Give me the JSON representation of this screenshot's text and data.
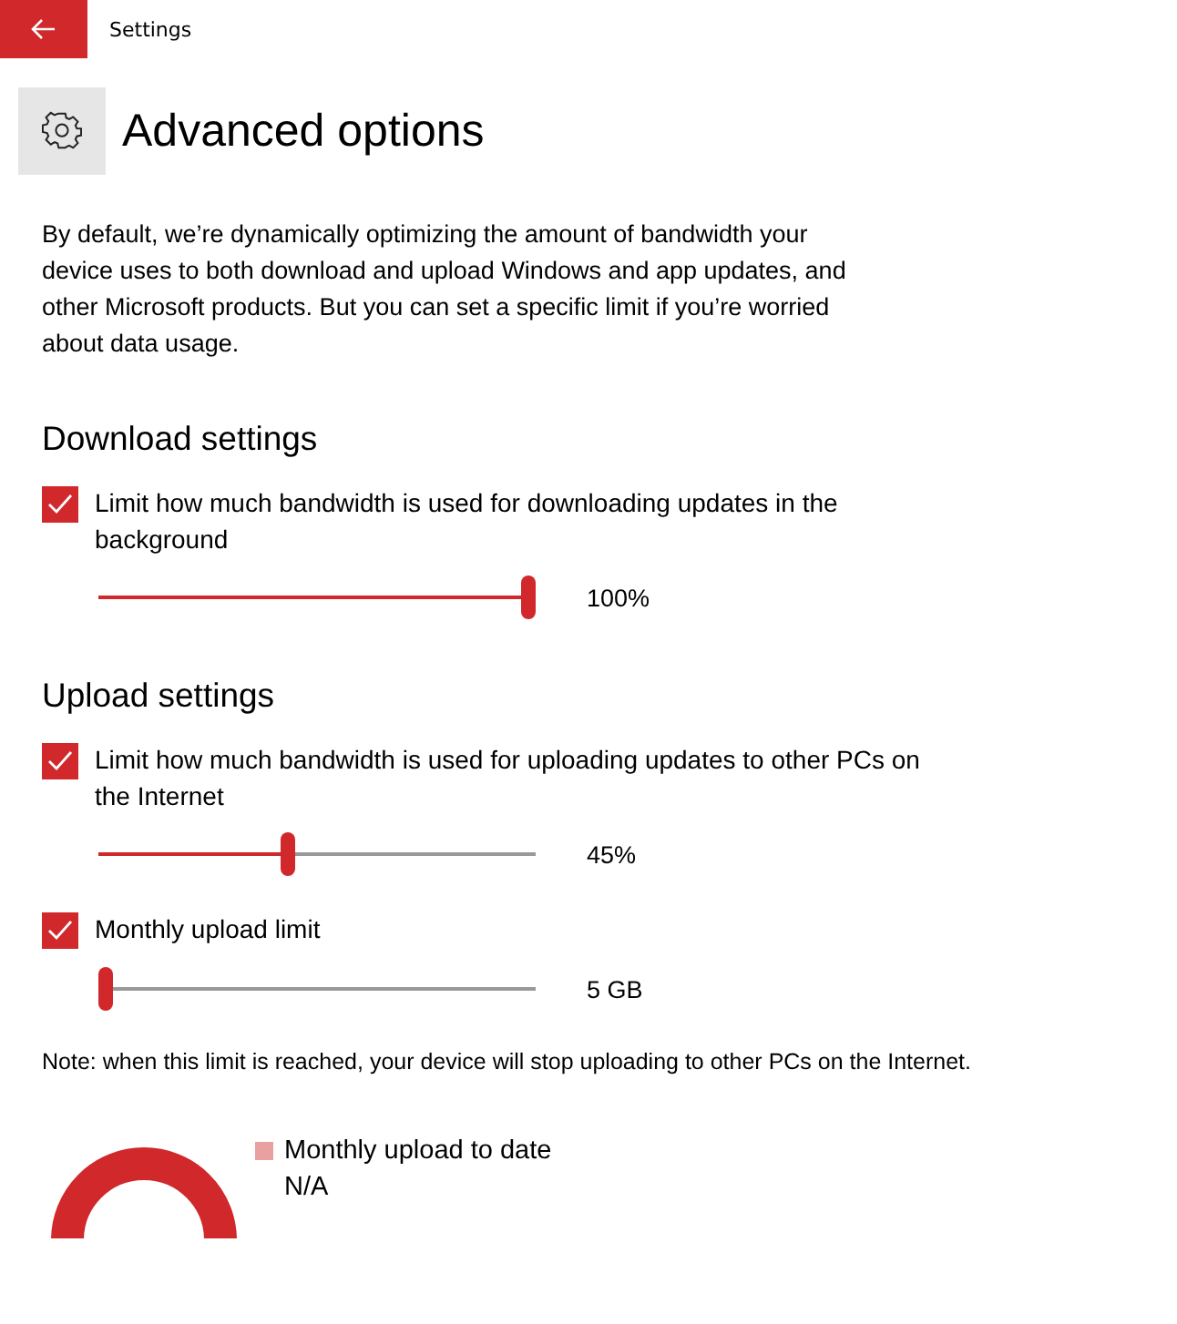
{
  "window": {
    "title": "Settings"
  },
  "page": {
    "title": "Advanced options",
    "description": "By default, we’re dynamically optimizing the amount of bandwidth your device uses to both download and upload Windows and app updates, and other Microsoft products. But you can set a specific limit if you’re worried about data usage."
  },
  "sections": [
    {
      "heading": "Download settings",
      "options": [
        {
          "label": "Limit how much bandwidth is used for downloading updates in the background",
          "checked": true,
          "level": 1.0,
          "reading": "100%"
        }
      ]
    },
    {
      "heading": "Upload settings",
      "options": [
        {
          "label": "Limit how much bandwidth is used for uploading updates to other PCs on the Internet",
          "checked": true,
          "level": 0.43,
          "reading": "45%"
        },
        {
          "label": "Monthly upload limit",
          "checked": true,
          "level": 0.0,
          "reading": "5 GB"
        }
      ]
    }
  ],
  "note": "Note: when this limit is reached, your device will stop uploading to other PCs on the Internet.",
  "legend": {
    "label": "Monthly upload to date",
    "value": "N/A"
  }
}
